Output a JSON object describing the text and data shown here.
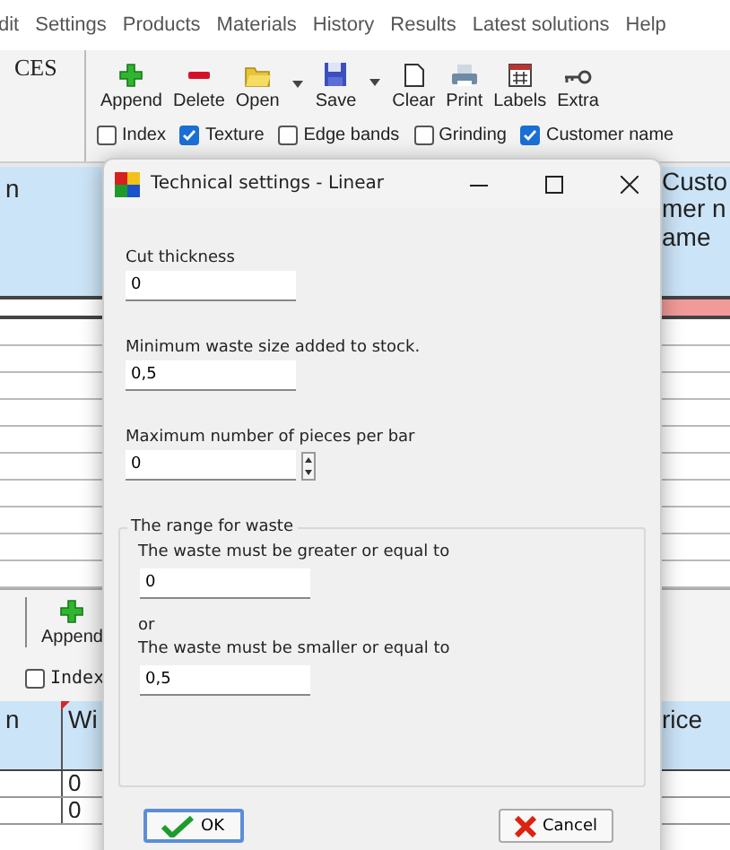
{
  "menu": [
    "dit",
    "Settings",
    "Products",
    "Materials",
    "History",
    "Results",
    "Latest solutions",
    "Help"
  ],
  "upper": {
    "panel_title": "CES",
    "toolbar": [
      {
        "kind": "append",
        "label": "Append",
        "dropdown": false
      },
      {
        "kind": "delete",
        "label": "Delete",
        "dropdown": false
      },
      {
        "kind": "open",
        "label": "Open",
        "dropdown": true
      },
      {
        "kind": "save",
        "label": "Save",
        "dropdown": true
      },
      {
        "kind": "clear",
        "label": "Clear",
        "dropdown": false
      },
      {
        "kind": "print",
        "label": "Print",
        "dropdown": false
      },
      {
        "kind": "labels",
        "label": "Labels",
        "dropdown": false
      },
      {
        "kind": "extra",
        "label": "Extra",
        "dropdown": false
      }
    ],
    "checkboxes": [
      {
        "label": "Index",
        "checked": false
      },
      {
        "label": "Texture",
        "checked": true
      },
      {
        "label": "Edge bands",
        "checked": false
      },
      {
        "label": "Grinding",
        "checked": false
      },
      {
        "label": "Customer name",
        "checked": true
      }
    ],
    "table": {
      "columns": [
        "n",
        "Customer name"
      ],
      "rows": [
        {
          "highlighted": true
        },
        {
          "highlighted": false
        },
        {
          "highlighted": false
        },
        {
          "highlighted": false
        },
        {
          "highlighted": false
        },
        {
          "highlighted": false
        },
        {
          "highlighted": false
        },
        {
          "highlighted": false
        },
        {
          "highlighted": false
        },
        {
          "highlighted": false
        },
        {
          "highlighted": false
        }
      ]
    }
  },
  "lower": {
    "toolbar": [
      {
        "kind": "append",
        "label": "Append",
        "dropdown": false
      }
    ],
    "checkboxes": [
      {
        "label": "Index",
        "checked": false
      }
    ],
    "table": {
      "columns": [
        "n",
        "Wi",
        "rice"
      ],
      "rows": [
        {
          "column_2": "0"
        },
        {
          "column_2": "0"
        }
      ]
    }
  },
  "dialog": {
    "title": "Technical settings - Linear",
    "fields": [
      {
        "kind": "text",
        "label": "Cut thickness",
        "value": "0"
      },
      {
        "kind": "text",
        "label": "Minimum waste size added to stock.",
        "value": "0,5"
      },
      {
        "kind": "spin",
        "label": "Maximum number of pieces per bar",
        "value": "0"
      }
    ],
    "group": {
      "title": "The range for waste",
      "items": [
        {
          "kind": "field",
          "label": "The waste must be greater or equal to",
          "value": "0"
        },
        {
          "kind": "note",
          "text": "or"
        },
        {
          "kind": "field",
          "label": "The waste must be smaller or equal to",
          "value": "0,5"
        }
      ]
    },
    "buttons": [
      {
        "kind": "ok",
        "label": "OK",
        "focused": true
      },
      {
        "kind": "cancel",
        "label": "Cancel",
        "focused": false
      }
    ]
  }
}
